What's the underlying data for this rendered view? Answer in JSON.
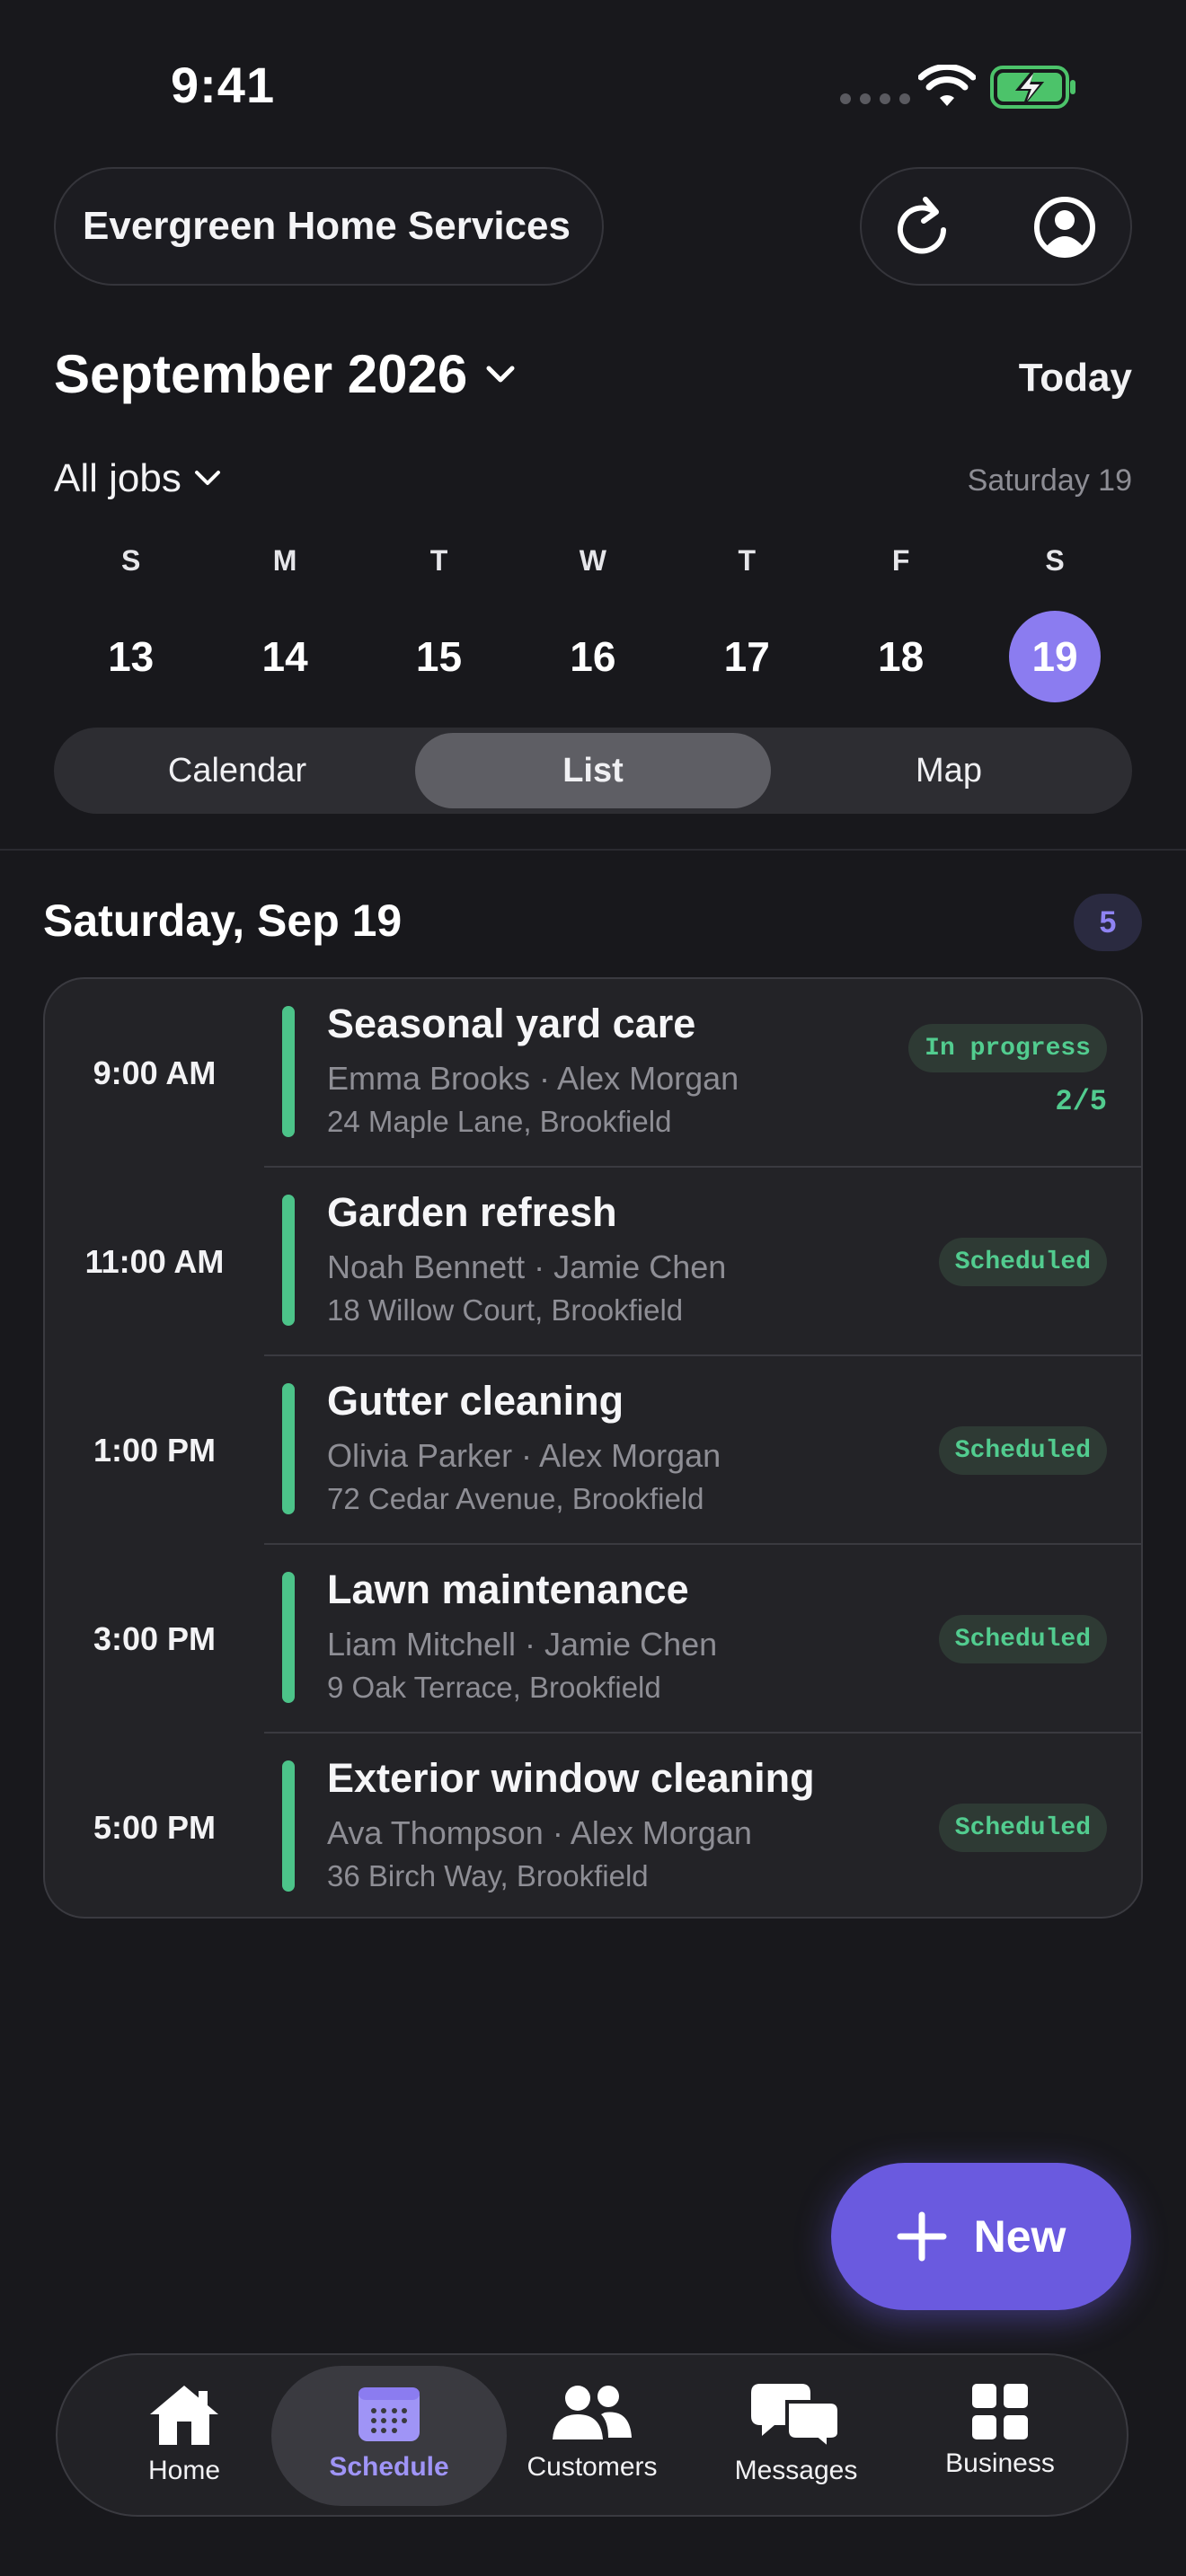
{
  "status_bar": {
    "time": "9:41"
  },
  "header": {
    "company": "Evergreen Home Services",
    "refresh_icon": "refresh-icon",
    "profile_icon": "profile-icon"
  },
  "calendar": {
    "month": "September 2026",
    "today_label": "Today",
    "filter": "All jobs",
    "selected_date": "Saturday 19",
    "week": [
      {
        "dow": "S",
        "day": "13"
      },
      {
        "dow": "M",
        "day": "14"
      },
      {
        "dow": "T",
        "day": "15"
      },
      {
        "dow": "W",
        "day": "16"
      },
      {
        "dow": "T",
        "day": "17"
      },
      {
        "dow": "F",
        "day": "18"
      },
      {
        "dow": "S",
        "day": "19"
      }
    ]
  },
  "view_switch": {
    "options": [
      "Calendar",
      "List",
      "Map"
    ],
    "selected": "List"
  },
  "day_section": {
    "title": "Saturday, Sep 19",
    "count": "5"
  },
  "jobs": [
    {
      "time": "9:00 AM",
      "title": "Seasonal yard care",
      "people": "Emma Brooks · Alex Morgan",
      "address": "24 Maple Lane, Brookfield",
      "status": "In progress",
      "progress": "2/5"
    },
    {
      "time": "11:00 AM",
      "title": "Garden refresh",
      "people": "Noah Bennett · Jamie Chen",
      "address": "18 Willow Court, Brookfield",
      "status": "Scheduled"
    },
    {
      "time": "1:00 PM",
      "title": "Gutter cleaning",
      "people": "Olivia Parker · Alex Morgan",
      "address": "72 Cedar Avenue, Brookfield",
      "status": "Scheduled"
    },
    {
      "time": "3:00 PM",
      "title": "Lawn maintenance",
      "people": "Liam Mitchell · Jamie Chen",
      "address": "9 Oak Terrace, Brookfield",
      "status": "Scheduled"
    },
    {
      "time": "5:00 PM",
      "title": "Exterior window cleaning",
      "people": "Ava Thompson · Alex Morgan",
      "address": "36 Birch Way, Brookfield",
      "status": "Scheduled"
    }
  ],
  "fab": {
    "label": "New"
  },
  "tab_bar": {
    "items": [
      {
        "label": "Home",
        "icon": "home-icon"
      },
      {
        "label": "Schedule",
        "icon": "calendar-icon"
      },
      {
        "label": "Customers",
        "icon": "people-icon"
      },
      {
        "label": "Messages",
        "icon": "chat-icon"
      },
      {
        "label": "Business",
        "icon": "grid-icon"
      }
    ],
    "active": "Schedule"
  },
  "colors": {
    "background": "#18181c",
    "accent": "#8b7cf0",
    "fab": "#6a5adf",
    "status_green": "#52cc8f",
    "job_bar": "#4cc389"
  }
}
